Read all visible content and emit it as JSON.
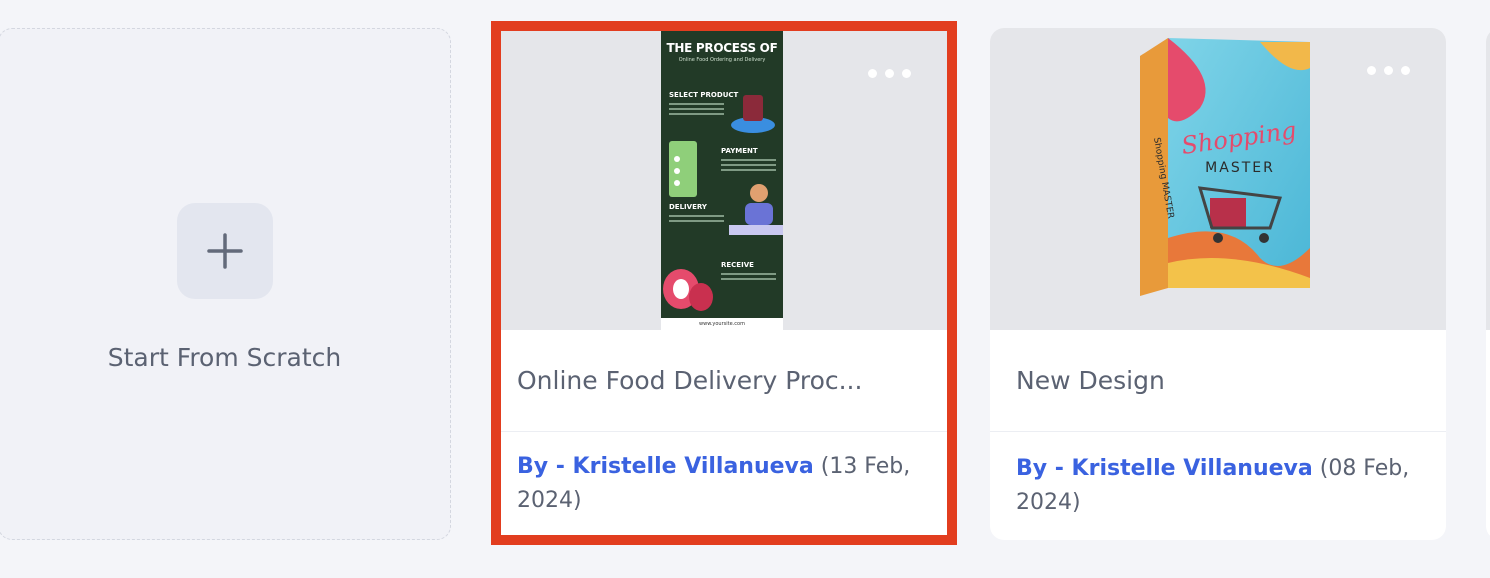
{
  "scratch": {
    "label": "Start From Scratch"
  },
  "cards": [
    {
      "title": "Online Food Delivery Proc...",
      "author": "By - Kristelle Villanueva",
      "date": "(13 Feb, 2024)",
      "selected": true,
      "thumbnail": {
        "heading": "THE PROCESS OF",
        "subheading": "Online Food Ordering and Delivery",
        "steps": [
          "SELECT PRODUCT",
          "PAYMENT",
          "DELIVERY",
          "RECEIVE"
        ],
        "footer": "www.yoursite.com"
      }
    },
    {
      "title": "New Design",
      "author": "By - Kristelle Villanueva",
      "date": "(08 Feb, 2024)",
      "selected": false,
      "thumbnail": {
        "line1": "Shopping",
        "line2": "MASTER",
        "spine": "Shopping MASTER"
      }
    }
  ],
  "colors": {
    "accent": "#3a62e0",
    "selection": "#e23d1f",
    "background": "#f4f5f9"
  }
}
